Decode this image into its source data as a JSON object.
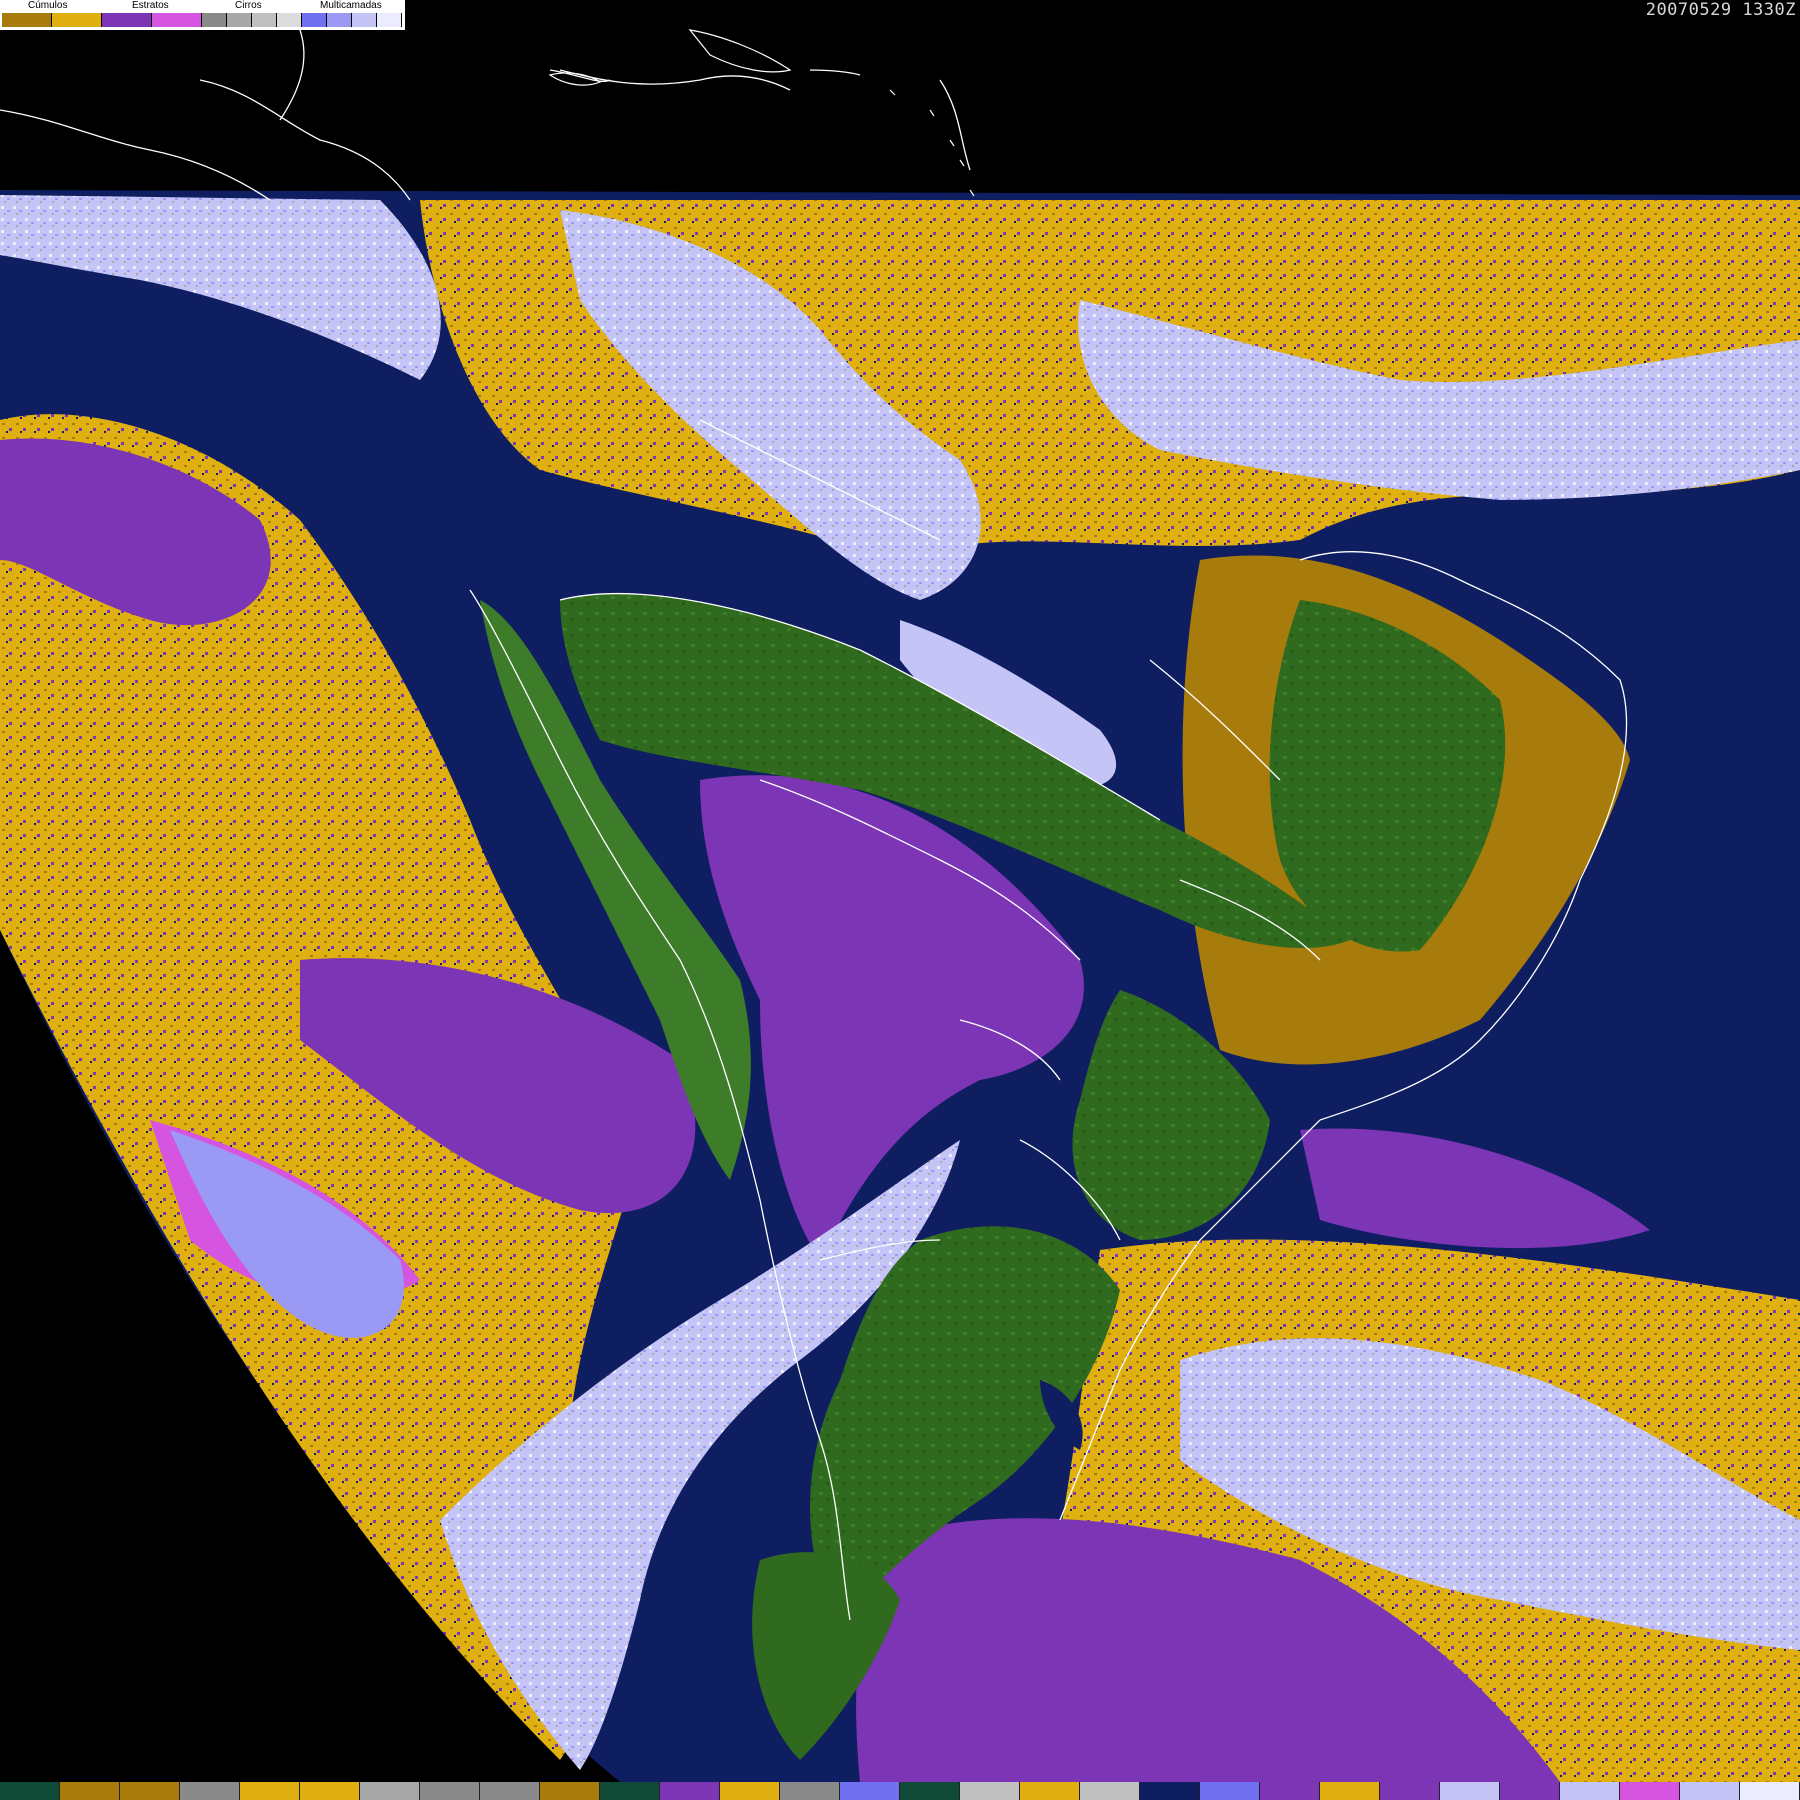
{
  "legend": {
    "categories": [
      {
        "label": "Cúmulos"
      },
      {
        "label": "Estratos"
      },
      {
        "label": "Cirros"
      },
      {
        "label": "Multicamadas"
      }
    ],
    "swatches": [
      "#a87c0c",
      "#e0b010",
      "#7c35b4",
      "#d655e0",
      "#8a8a8a",
      "#a8a8a8",
      "#c0c0c0",
      "#dcdcdc",
      "#7070f0",
      "#9a9af4",
      "#c4c4f6",
      "#ececff"
    ]
  },
  "timestamp": "20070529 1330Z",
  "colors": {
    "ocean": "#0e1e60",
    "cumulus_dark": "#a87c0c",
    "cumulus_light": "#e0b010",
    "stratus_dark": "#7c35b4",
    "stratus_light": "#d655e0",
    "cirrus_gray": "#a8a8a8",
    "multilayer_blue": "#7070f0",
    "multilayer_pale": "#c4c4f6",
    "land_green": "#2f6a1e",
    "background": "#000000",
    "borders": "#ffffff"
  },
  "bottom_strip": [
    "#0f4a36",
    "#a87c0c",
    "#a87c0c",
    "#8a8a8a",
    "#e0b010",
    "#e0b010",
    "#a8a8a8",
    "#8a8a8a",
    "#8a8a8a",
    "#a87c0c",
    "#0f4a36",
    "#7c35b4",
    "#e0b010",
    "#8a8a8a",
    "#7070f0",
    "#0f4a36",
    "#c0c0c0",
    "#e0b010",
    "#c0c0c0",
    "#0e1e60",
    "#7070f0",
    "#7c35b4",
    "#e0b010",
    "#7c35b4",
    "#c4c4f6",
    "#7c35b4",
    "#c4c4f6",
    "#d655e0",
    "#c4c4f6",
    "#ececff"
  ]
}
